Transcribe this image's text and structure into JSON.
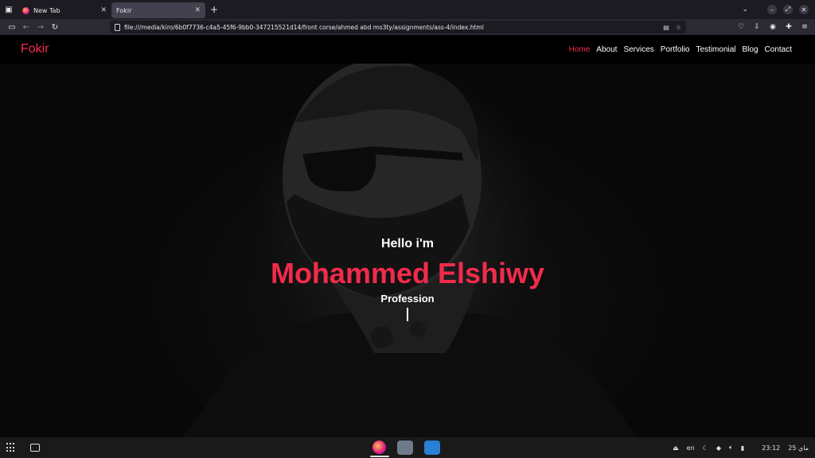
{
  "browser": {
    "tabs": [
      {
        "title": "New Tab",
        "active": false
      },
      {
        "title": "Fokir",
        "active": true
      }
    ],
    "url": "file:///media/kiro/6b0f7736-c4a5-45f6-9bb0-347215521d14/front corse/ahmed abd mo3ty/assignments/ass-4/index.html"
  },
  "site": {
    "brand": "Fokir",
    "nav": [
      "Home",
      "About",
      "Services",
      "Portfolio",
      "Testimonial",
      "Blog",
      "Contact"
    ],
    "hero": {
      "greeting": "Hello i'm",
      "name": "Mohammed Elshiwy",
      "profession": "Profession"
    },
    "accent_color": "#f22b4b"
  },
  "taskbar": {
    "language": "en",
    "clock": "23:12",
    "date": "25 ماي"
  }
}
